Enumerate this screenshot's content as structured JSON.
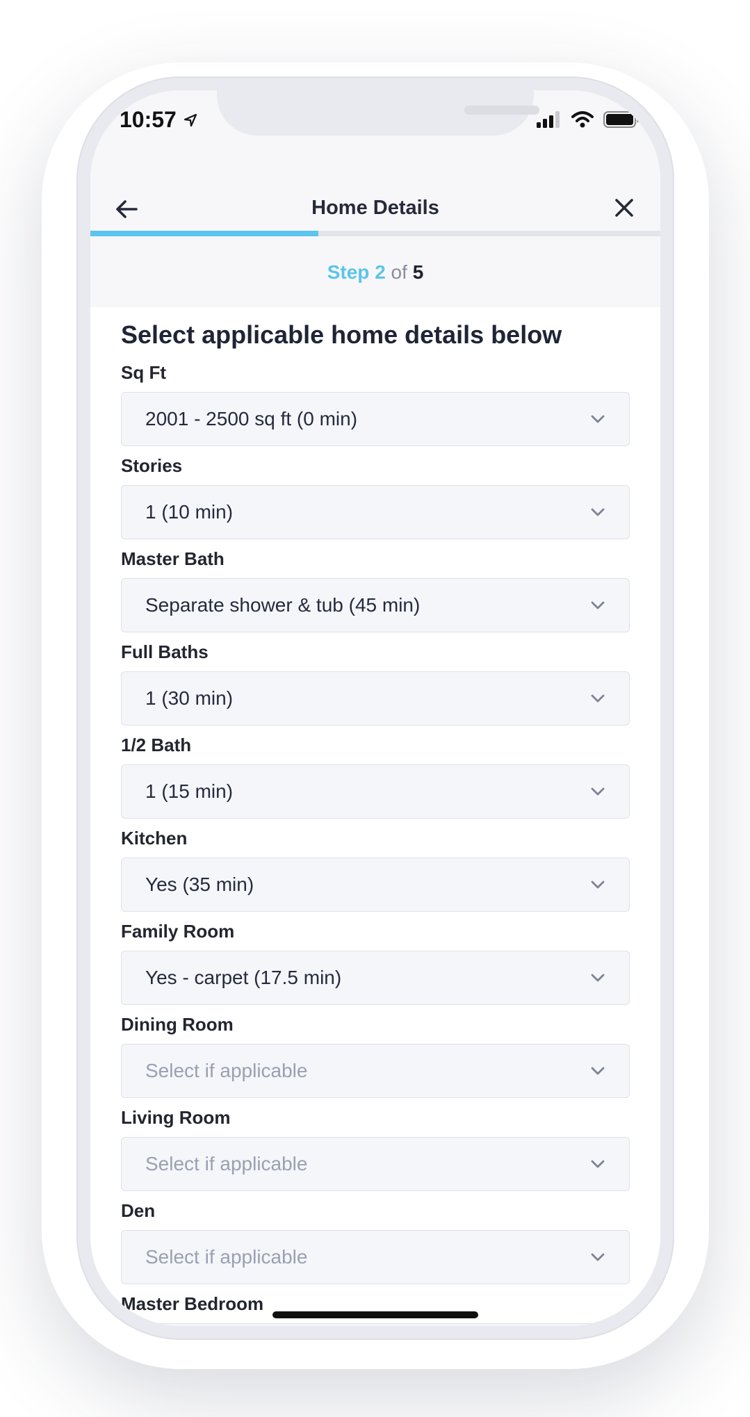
{
  "status_bar": {
    "time": "10:57"
  },
  "nav": {
    "title": "Home Details"
  },
  "progress": {
    "fraction": 0.4
  },
  "step": {
    "prefix": "Step 2",
    "of": "of",
    "total": "5"
  },
  "heading": "Select applicable home details below",
  "fields": [
    {
      "label": "Sq Ft",
      "value": "2001 - 2500 sq ft (0 min)",
      "placeholder": false
    },
    {
      "label": "Stories",
      "value": "1 (10 min)",
      "placeholder": false
    },
    {
      "label": "Master Bath",
      "value": "Separate shower & tub (45 min)",
      "placeholder": false
    },
    {
      "label": "Full Baths",
      "value": "1 (30 min)",
      "placeholder": false
    },
    {
      "label": "1/2 Bath",
      "value": "1 (15 min)",
      "placeholder": false
    },
    {
      "label": "Kitchen",
      "value": "Yes (35 min)",
      "placeholder": false
    },
    {
      "label": "Family Room",
      "value": "Yes - carpet (17.5 min)",
      "placeholder": false
    },
    {
      "label": "Dining Room",
      "value": "Select if applicable",
      "placeholder": true
    },
    {
      "label": "Living Room",
      "value": "Select if applicable",
      "placeholder": true
    },
    {
      "label": "Den",
      "value": "Select if applicable",
      "placeholder": true
    },
    {
      "label": "Master Bedroom",
      "value": "",
      "placeholder": true
    }
  ],
  "colors": {
    "accent": "#5bc5ec",
    "text_dark": "#25293b",
    "field_bg": "#f5f6fa"
  },
  "icons": [
    "location-arrow-icon",
    "cellular-signal-icon",
    "wifi-icon",
    "battery-icon",
    "back-arrow-icon",
    "close-icon",
    "chevron-down-icon"
  ]
}
